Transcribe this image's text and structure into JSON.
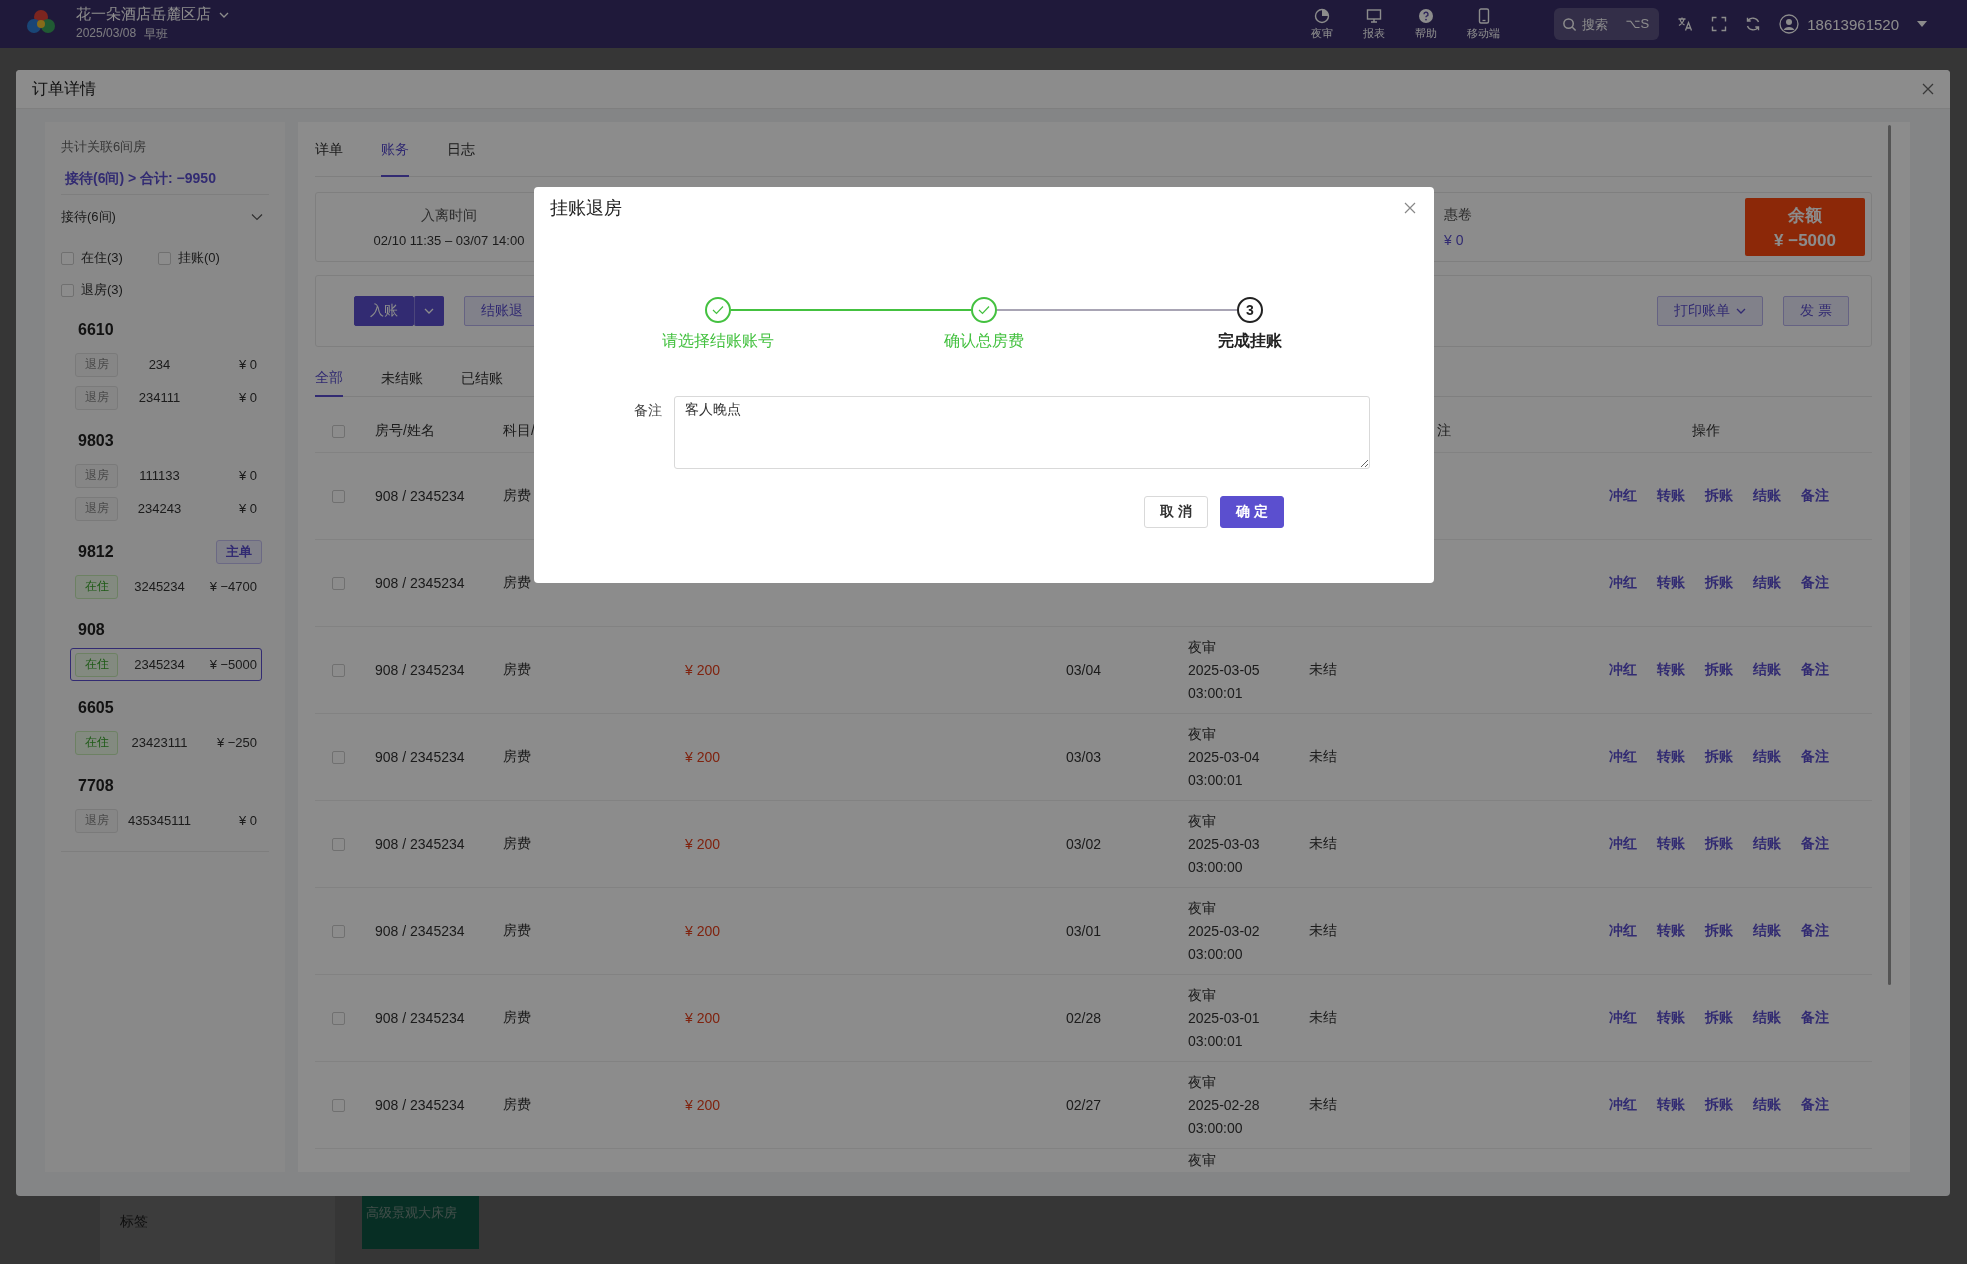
{
  "app_bar": {
    "store": "花一朵酒店岳麓区店",
    "date": "2025/03/08",
    "shift": "早班",
    "tools": [
      {
        "label": "夜审",
        "kind": "audit"
      },
      {
        "label": "报表",
        "kind": "report"
      },
      {
        "label": "帮助",
        "kind": "help"
      },
      {
        "label": "移动端",
        "kind": "mobile"
      }
    ],
    "search": {
      "placeholder": "搜索",
      "shortcut": "⌥S"
    },
    "user": "18613961520"
  },
  "background": {
    "tag_label": "标签",
    "room_type": "高级景观大床房"
  },
  "drawer": {
    "title": "订单详情",
    "summary": {
      "linked": "共计关联6间房",
      "total": "接待(6间) > 合计: −9950"
    },
    "group": {
      "label": "接待(6间)",
      "expanded": true
    },
    "filters": [
      {
        "label": "在住(3)",
        "checked": false
      },
      {
        "label": "挂账(0)",
        "checked": false
      },
      {
        "label": "退房(3)",
        "checked": false
      }
    ],
    "rooms": [
      {
        "number": "6610",
        "guests": [
          {
            "status": "退房",
            "kind": "out",
            "account": "234",
            "balance": "¥ 0",
            "selected": false
          },
          {
            "status": "退房",
            "kind": "out",
            "account": "234111",
            "balance": "¥ 0",
            "selected": false
          }
        ]
      },
      {
        "number": "9803",
        "guests": [
          {
            "status": "退房",
            "kind": "out",
            "account": "111133",
            "balance": "¥ 0",
            "selected": false
          },
          {
            "status": "退房",
            "kind": "out",
            "account": "234243",
            "balance": "¥ 0",
            "selected": false
          }
        ]
      },
      {
        "number": "9812",
        "badge": "主单",
        "guests": [
          {
            "status": "在住",
            "kind": "in",
            "account": "3245234",
            "balance": "¥ −4700",
            "selected": false
          }
        ]
      },
      {
        "number": "908",
        "guests": [
          {
            "status": "在住",
            "kind": "in",
            "account": "2345234",
            "balance": "¥ −5000",
            "selected": true
          }
        ]
      },
      {
        "number": "6605",
        "guests": [
          {
            "status": "在住",
            "kind": "in",
            "account": "23423111",
            "balance": "¥ −250",
            "selected": false
          }
        ]
      },
      {
        "number": "7708",
        "guests": [
          {
            "status": "退房",
            "kind": "out",
            "account": "435345111",
            "balance": "¥ 0",
            "selected": false
          }
        ]
      }
    ],
    "tabs": [
      {
        "label": "详单",
        "selected": false
      },
      {
        "label": "账务",
        "selected": true
      },
      {
        "label": "日志",
        "selected": false
      }
    ],
    "stay": {
      "label": "入离时间",
      "value": "02/10 11:35 – 03/07 14:00"
    },
    "coupon": {
      "label": "惠卷",
      "value": "¥ 0"
    },
    "balance": {
      "label": "余额",
      "value": "¥ −5000"
    },
    "actions_left": [
      {
        "label": "入账",
        "kind": "split"
      },
      {
        "label": "结账退",
        "kind": "outline"
      }
    ],
    "actions_right": [
      {
        "label": "打印账单",
        "kind": "dropdown"
      },
      {
        "label": "发 票",
        "kind": "outline"
      }
    ],
    "filter_tabs": [
      {
        "label": "全部",
        "selected": true
      },
      {
        "label": "未结账",
        "selected": false
      },
      {
        "label": "已结账",
        "selected": false
      }
    ],
    "table": {
      "all_checked": false,
      "columns": {
        "room": "房号/姓名",
        "subject": "科目/",
        "note": "注",
        "actions": "操作"
      },
      "rows": [
        {
          "kind": "full",
          "checked": false,
          "room": "908 / 2345234",
          "subject": "房费",
          "actions": [
            "冲红",
            "转账",
            "拆账",
            "结账",
            "备注"
          ]
        },
        {
          "kind": "full",
          "checked": false,
          "room": "908 / 2345234",
          "subject": "房费",
          "actions": [
            "冲红",
            "转账",
            "拆账",
            "结账",
            "备注"
          ]
        },
        {
          "kind": "full",
          "checked": false,
          "room": "908 / 2345234",
          "subject": "房费",
          "amount": "¥ 200",
          "date": "03/04",
          "audit": [
            "夜审",
            "2025-03-05",
            "03:00:01"
          ],
          "status": "未结",
          "actions": [
            "冲红",
            "转账",
            "拆账",
            "结账",
            "备注"
          ]
        },
        {
          "kind": "full",
          "checked": false,
          "room": "908 / 2345234",
          "subject": "房费",
          "amount": "¥ 200",
          "date": "03/03",
          "audit": [
            "夜审",
            "2025-03-04",
            "03:00:01"
          ],
          "status": "未结",
          "actions": [
            "冲红",
            "转账",
            "拆账",
            "结账",
            "备注"
          ]
        },
        {
          "kind": "full",
          "checked": false,
          "room": "908 / 2345234",
          "subject": "房费",
          "amount": "¥ 200",
          "date": "03/02",
          "audit": [
            "夜审",
            "2025-03-03",
            "03:00:00"
          ],
          "status": "未结",
          "actions": [
            "冲红",
            "转账",
            "拆账",
            "结账",
            "备注"
          ]
        },
        {
          "kind": "full",
          "checked": false,
          "room": "908 / 2345234",
          "subject": "房费",
          "amount": "¥ 200",
          "date": "03/01",
          "audit": [
            "夜审",
            "2025-03-02",
            "03:00:00"
          ],
          "status": "未结",
          "actions": [
            "冲红",
            "转账",
            "拆账",
            "结账",
            "备注"
          ]
        },
        {
          "kind": "full",
          "checked": false,
          "room": "908 / 2345234",
          "subject": "房费",
          "amount": "¥ 200",
          "date": "02/28",
          "audit": [
            "夜审",
            "2025-03-01",
            "03:00:01"
          ],
          "status": "未结",
          "actions": [
            "冲红",
            "转账",
            "拆账",
            "结账",
            "备注"
          ]
        },
        {
          "kind": "full",
          "checked": false,
          "room": "908 / 2345234",
          "subject": "房费",
          "amount": "¥ 200",
          "date": "02/27",
          "audit": [
            "夜审",
            "2025-02-28",
            "03:00:00"
          ],
          "status": "未结",
          "actions": [
            "冲红",
            "转账",
            "拆账",
            "结账",
            "备注"
          ]
        },
        {
          "kind": "partial",
          "audit": [
            "夜审"
          ]
        }
      ]
    }
  },
  "modal": {
    "title": "挂账退房",
    "steps": [
      {
        "label": "请选择结账账号",
        "completed": true
      },
      {
        "label": "确认总房费",
        "completed": true
      },
      {
        "label": "完成挂账",
        "number": "3",
        "completed": false
      }
    ],
    "field_label": "备注",
    "remark": "客人晚点",
    "cancel": "取 消",
    "confirm": "确 定"
  }
}
